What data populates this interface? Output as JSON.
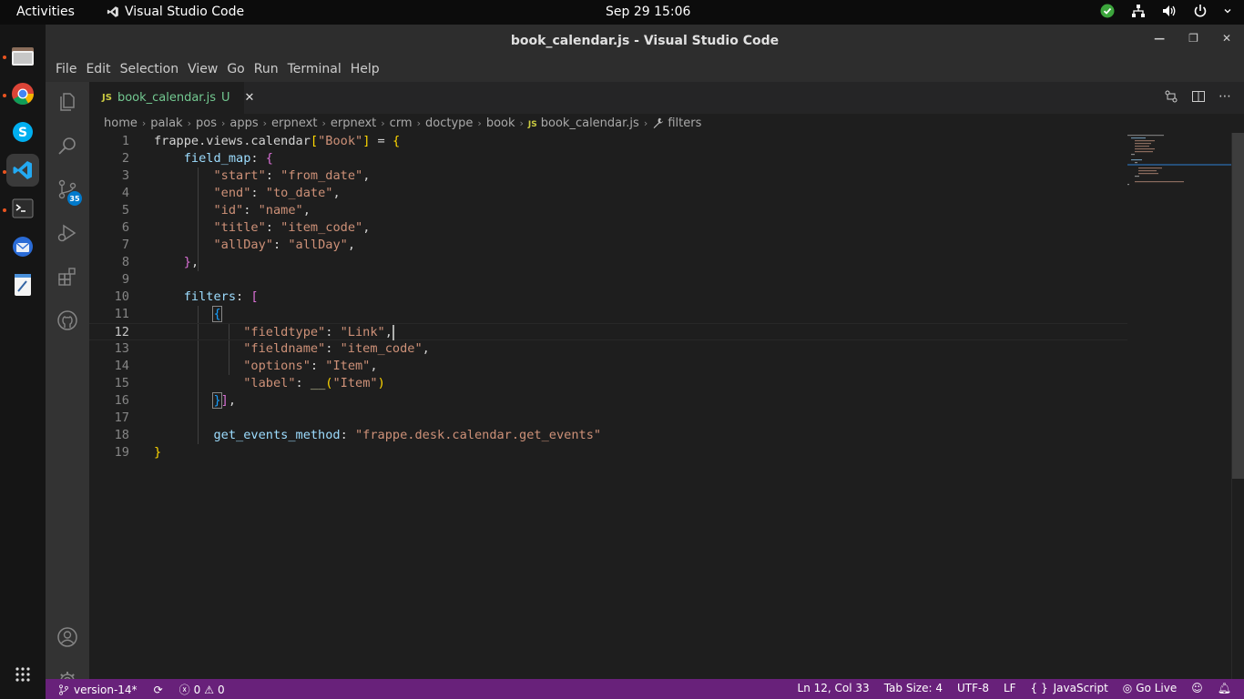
{
  "topbar": {
    "activities": "Activities",
    "app_name": "Visual Studio Code",
    "clock": "Sep 29  15:06"
  },
  "dock": {
    "items": [
      "files-icon",
      "chrome-icon",
      "skype-icon",
      "vscode-icon",
      "terminal-icon",
      "thunderbird-icon",
      "text-editor-icon",
      "app-grid-icon"
    ]
  },
  "window": {
    "title": "book_calendar.js - Visual Studio Code",
    "menu": [
      "File",
      "Edit",
      "Selection",
      "View",
      "Go",
      "Run",
      "Terminal",
      "Help"
    ]
  },
  "activitybar": {
    "scm_badge": "35"
  },
  "tab": {
    "icon_text": "JS",
    "filename": "book_calendar.js",
    "status": "U"
  },
  "breadcrumb": {
    "segments": [
      "home",
      "palak",
      "pos",
      "apps",
      "erpnext",
      "erpnext",
      "crm",
      "doctype",
      "book"
    ],
    "file_icon": "JS",
    "file": "book_calendar.js",
    "symbol": "filters"
  },
  "code": {
    "line_numbers": [
      "1",
      "2",
      "3",
      "4",
      "5",
      "6",
      "7",
      "8",
      "9",
      "10",
      "11",
      "12",
      "13",
      "14",
      "15",
      "16",
      "17",
      "18",
      "19"
    ],
    "current_line": 12
  },
  "statusbar": {
    "branch": "version-14*",
    "errors": "0",
    "warnings": "0",
    "position": "Ln 12, Col 33",
    "tab_size": "Tab Size: 4",
    "encoding": "UTF-8",
    "eol": "LF",
    "language": "JavaScript",
    "go_live": "Go Live"
  },
  "colors": {
    "status_bar": "#68217a",
    "editor_bg": "#1e1e1e",
    "accent": "#007acc"
  }
}
